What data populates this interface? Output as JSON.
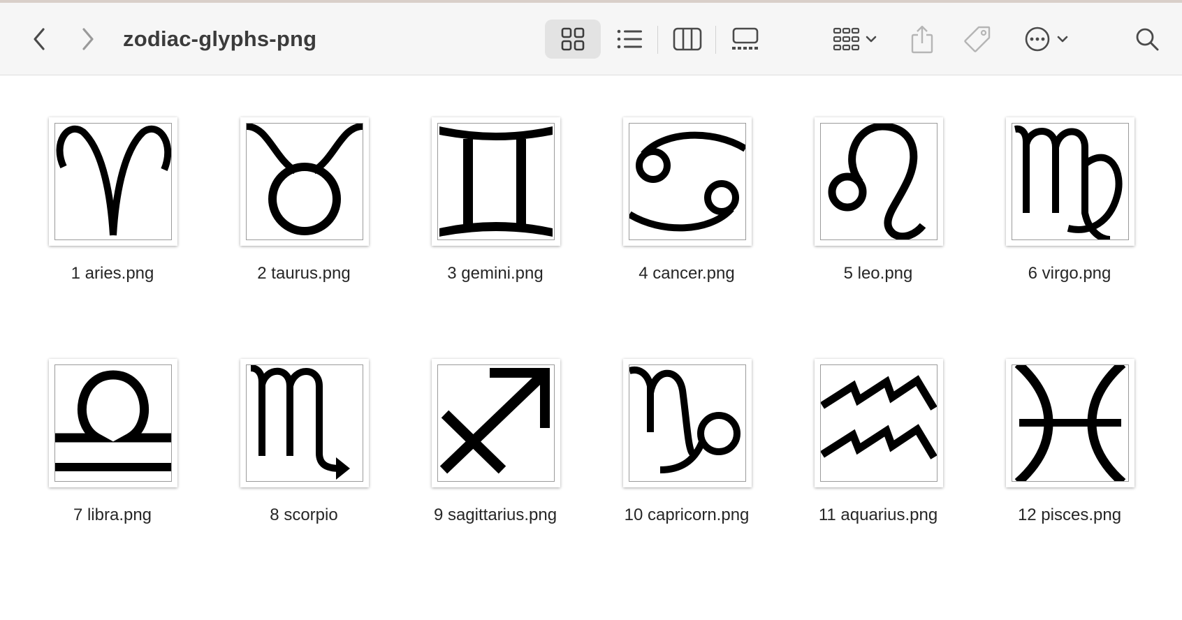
{
  "window": {
    "title": "zodiac-glyphs-png"
  },
  "toolbar": {
    "back_icon": "chevron-left-icon",
    "forward_icon": "chevron-right-icon",
    "views": [
      "icon-view",
      "list-view",
      "column-view",
      "gallery-view"
    ],
    "active_view": "icon-view",
    "group_icon": "group-by-icon",
    "share_icon": "share-icon",
    "tag_icon": "tag-icon",
    "more_icon": "ellipsis-circle-icon",
    "search_icon": "search-icon"
  },
  "files": [
    {
      "name": "1 aries.png",
      "glyph": "aries"
    },
    {
      "name": "2 taurus.png",
      "glyph": "taurus"
    },
    {
      "name": "3 gemini.png",
      "glyph": "gemini"
    },
    {
      "name": "4 cancer.png",
      "glyph": "cancer"
    },
    {
      "name": "5 leo.png",
      "glyph": "leo"
    },
    {
      "name": "6 virgo.png",
      "glyph": "virgo"
    },
    {
      "name": "7 libra.png",
      "glyph": "libra"
    },
    {
      "name": "8 scorpio",
      "glyph": "scorpio"
    },
    {
      "name": "9 sagittarius.png",
      "glyph": "sagittarius"
    },
    {
      "name": "10 capricorn.png",
      "glyph": "capricorn"
    },
    {
      "name": "11 aquarius.png",
      "glyph": "aquarius"
    },
    {
      "name": "12 pisces.png",
      "glyph": "pisces"
    }
  ],
  "colors": {
    "toolbar_bg": "#f6f6f6",
    "active_segment": "#e3e3e3",
    "icon": "#4a4a4a",
    "icon_dim": "#b5b5b5",
    "glyph": "#000000"
  }
}
